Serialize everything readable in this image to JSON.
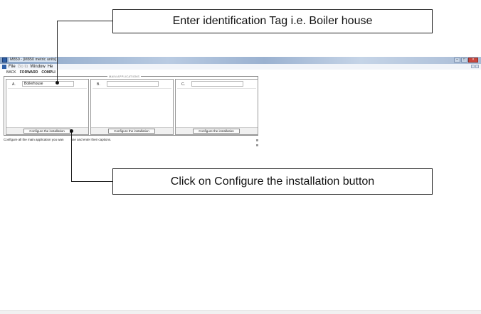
{
  "window": {
    "title": "M850 - [M850 metric units]",
    "controls": [
      "minimize",
      "maximize",
      "close"
    ]
  },
  "menu": {
    "items": [
      {
        "label": "File",
        "enabled": true
      },
      {
        "label": "Go to",
        "enabled": false
      },
      {
        "label": "Window",
        "enabled": true
      },
      {
        "label": "He",
        "enabled": true
      }
    ]
  },
  "nav": {
    "back": "BACK",
    "forward": "FORWARD",
    "complete": "COMPLI"
  },
  "main": {
    "group_title": "MAIN APPLICATIONS",
    "panels": [
      {
        "letter": "A.",
        "tag": "Boilerhouse",
        "button": "Configure the installation"
      },
      {
        "letter": "B.",
        "tag": "",
        "button": "Configure the installation"
      },
      {
        "letter": "C.",
        "tag": "",
        "button": "Configure the installation"
      }
    ],
    "hint_part1": "Configure all the main application you wan",
    "hint_part2": "use and enter their captions."
  },
  "annotations": {
    "top": "Enter identification Tag i.e. Boiler house",
    "bottom": "Click on Configure the installation button"
  },
  "colors": {
    "titlebar": "#9ab1d0",
    "close_button": "#c9463d"
  }
}
